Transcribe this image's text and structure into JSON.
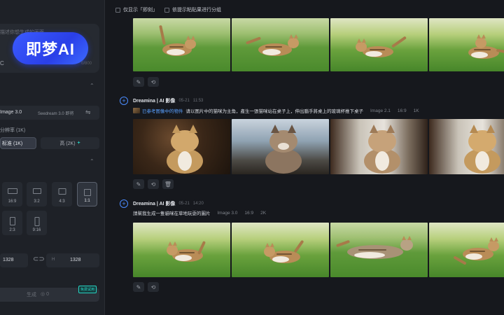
{
  "left_panel": {
    "logo_text": "即梦AI",
    "prompt_placeholder": "描述你想生成的画面",
    "prompt_prefix": "C",
    "char_count": "0/800",
    "model_label": "Image 3.0",
    "model_alt": "Seedream 3.0 即将",
    "resolution_label": "分辨率 (1K)",
    "resolution_options": [
      "标准 (1K)",
      "高 (2K)"
    ],
    "aspect_ratios": [
      "16:9",
      "3:2",
      "4:3",
      "1:1",
      "2:3",
      "9:16"
    ],
    "selected_ratio": "1:1",
    "width_value": "1328",
    "height_label": "H",
    "height_value": "1328",
    "generate_label": "生成",
    "generate_cost": "0",
    "free_badge": "免费试用"
  },
  "main": {
    "filters": [
      "仅显示「即刻」",
      "依提示粘贴果进行分组"
    ],
    "messages": [
      {
        "sender": "Dreamina | AI 影像",
        "date": "05-21",
        "time": "11:53",
        "reference_label": "已参考图像中的物件",
        "prompt": "请以图片中的猫咪为主角，產生一張猫咪站在桌子上，伸出腦手將桌上的玻璃杯推下桌子",
        "model": "Image 2.1",
        "ratio": "16:9",
        "resolution": "1K"
      },
      {
        "sender": "Dreamina | AI 影像",
        "date": "05-21",
        "time": "14:20",
        "prompt": "請幫我生成一隻貓咪在草地玩耍的圖片",
        "model": "Image 3.0",
        "ratio": "16:9",
        "resolution": "2K"
      }
    ]
  }
}
